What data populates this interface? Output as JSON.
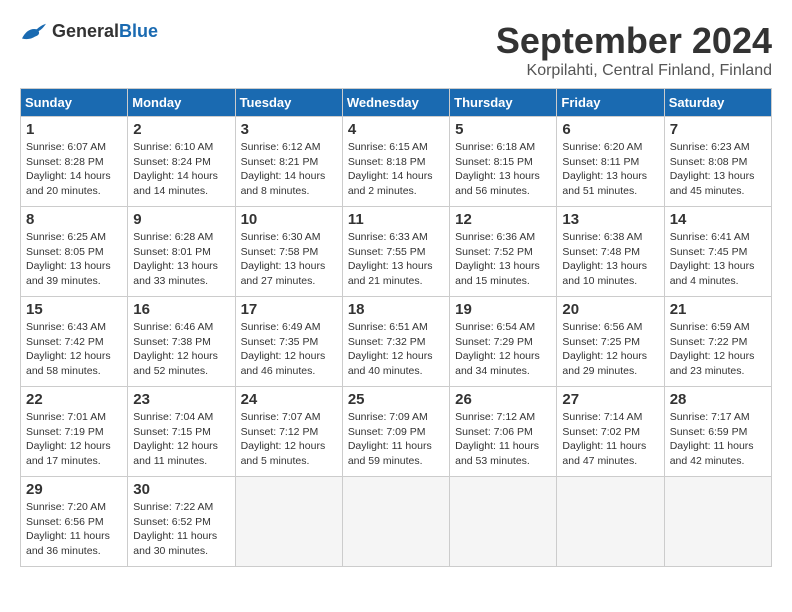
{
  "header": {
    "logo_general": "General",
    "logo_blue": "Blue",
    "month_title": "September 2024",
    "location": "Korpilahti, Central Finland, Finland"
  },
  "weekdays": [
    "Sunday",
    "Monday",
    "Tuesday",
    "Wednesday",
    "Thursday",
    "Friday",
    "Saturday"
  ],
  "days": [
    {
      "day": "",
      "empty": true
    },
    {
      "day": "",
      "empty": true
    },
    {
      "day": "",
      "empty": true
    },
    {
      "day": "",
      "empty": true
    },
    {
      "day": "",
      "empty": true
    },
    {
      "day": "",
      "empty": true
    },
    {
      "day": "7",
      "sunrise": "6:23 AM",
      "sunset": "8:08 PM",
      "daylight": "13 hours and 45 minutes."
    },
    {
      "day": "8",
      "sunrise": "6:25 AM",
      "sunset": "8:05 PM",
      "daylight": "13 hours and 39 minutes."
    },
    {
      "day": "9",
      "sunrise": "6:28 AM",
      "sunset": "8:01 PM",
      "daylight": "13 hours and 33 minutes."
    },
    {
      "day": "10",
      "sunrise": "6:30 AM",
      "sunset": "7:58 PM",
      "daylight": "13 hours and 27 minutes."
    },
    {
      "day": "11",
      "sunrise": "6:33 AM",
      "sunset": "7:55 PM",
      "daylight": "13 hours and 21 minutes."
    },
    {
      "day": "12",
      "sunrise": "6:36 AM",
      "sunset": "7:52 PM",
      "daylight": "13 hours and 15 minutes."
    },
    {
      "day": "13",
      "sunrise": "6:38 AM",
      "sunset": "7:48 PM",
      "daylight": "13 hours and 10 minutes."
    },
    {
      "day": "14",
      "sunrise": "6:41 AM",
      "sunset": "7:45 PM",
      "daylight": "13 hours and 4 minutes."
    },
    {
      "day": "15",
      "sunrise": "6:43 AM",
      "sunset": "7:42 PM",
      "daylight": "12 hours and 58 minutes."
    },
    {
      "day": "16",
      "sunrise": "6:46 AM",
      "sunset": "7:38 PM",
      "daylight": "12 hours and 52 minutes."
    },
    {
      "day": "17",
      "sunrise": "6:49 AM",
      "sunset": "7:35 PM",
      "daylight": "12 hours and 46 minutes."
    },
    {
      "day": "18",
      "sunrise": "6:51 AM",
      "sunset": "7:32 PM",
      "daylight": "12 hours and 40 minutes."
    },
    {
      "day": "19",
      "sunrise": "6:54 AM",
      "sunset": "7:29 PM",
      "daylight": "12 hours and 34 minutes."
    },
    {
      "day": "20",
      "sunrise": "6:56 AM",
      "sunset": "7:25 PM",
      "daylight": "12 hours and 29 minutes."
    },
    {
      "day": "21",
      "sunrise": "6:59 AM",
      "sunset": "7:22 PM",
      "daylight": "12 hours and 23 minutes."
    },
    {
      "day": "22",
      "sunrise": "7:01 AM",
      "sunset": "7:19 PM",
      "daylight": "12 hours and 17 minutes."
    },
    {
      "day": "23",
      "sunrise": "7:04 AM",
      "sunset": "7:15 PM",
      "daylight": "12 hours and 11 minutes."
    },
    {
      "day": "24",
      "sunrise": "7:07 AM",
      "sunset": "7:12 PM",
      "daylight": "12 hours and 5 minutes."
    },
    {
      "day": "25",
      "sunrise": "7:09 AM",
      "sunset": "7:09 PM",
      "daylight": "11 hours and 59 minutes."
    },
    {
      "day": "26",
      "sunrise": "7:12 AM",
      "sunset": "7:06 PM",
      "daylight": "11 hours and 53 minutes."
    },
    {
      "day": "27",
      "sunrise": "7:14 AM",
      "sunset": "7:02 PM",
      "daylight": "11 hours and 47 minutes."
    },
    {
      "day": "28",
      "sunrise": "7:17 AM",
      "sunset": "6:59 PM",
      "daylight": "11 hours and 42 minutes."
    },
    {
      "day": "29",
      "sunrise": "7:20 AM",
      "sunset": "6:56 PM",
      "daylight": "11 hours and 36 minutes."
    },
    {
      "day": "30",
      "sunrise": "7:22 AM",
      "sunset": "6:52 PM",
      "daylight": "11 hours and 30 minutes."
    },
    {
      "day": "",
      "empty": true
    },
    {
      "day": "",
      "empty": true
    },
    {
      "day": "",
      "empty": true
    },
    {
      "day": "",
      "empty": true
    },
    {
      "day": "",
      "empty": true
    }
  ],
  "week1": [
    {
      "day": "1",
      "sunrise": "6:07 AM",
      "sunset": "8:28 PM",
      "daylight": "14 hours and 20 minutes."
    },
    {
      "day": "2",
      "sunrise": "6:10 AM",
      "sunset": "8:24 PM",
      "daylight": "14 hours and 14 minutes."
    },
    {
      "day": "3",
      "sunrise": "6:12 AM",
      "sunset": "8:21 PM",
      "daylight": "14 hours and 8 minutes."
    },
    {
      "day": "4",
      "sunrise": "6:15 AM",
      "sunset": "8:18 PM",
      "daylight": "14 hours and 2 minutes."
    },
    {
      "day": "5",
      "sunrise": "6:18 AM",
      "sunset": "8:15 PM",
      "daylight": "13 hours and 56 minutes."
    },
    {
      "day": "6",
      "sunrise": "6:20 AM",
      "sunset": "8:11 PM",
      "daylight": "13 hours and 51 minutes."
    },
    {
      "day": "7",
      "sunrise": "6:23 AM",
      "sunset": "8:08 PM",
      "daylight": "13 hours and 45 minutes."
    }
  ]
}
